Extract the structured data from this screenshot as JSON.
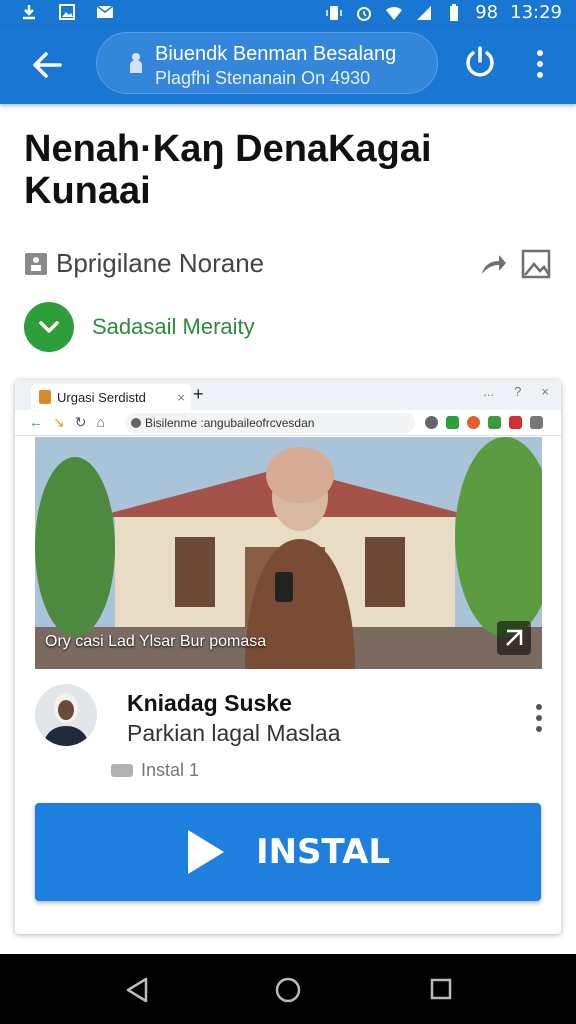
{
  "status_bar": {
    "battery": "98",
    "time": "13:29",
    "icons": [
      "download-icon",
      "gallery-icon",
      "mail-icon",
      "vibrate-icon",
      "alarm-icon",
      "wifi-icon",
      "signal-icon",
      "battery-icon"
    ]
  },
  "app_bar": {
    "url_title": "Biuendk Benman Besalang",
    "url_subtitle": "Plagfhi Stenanain On 4930",
    "icons": [
      "back-arrow-icon",
      "lock-icon",
      "power-icon",
      "more-vert-icon"
    ]
  },
  "page": {
    "title": "Nenah·Kaŋ DenaKagai Kunaai",
    "publisher": "Bprigilane Norane",
    "verified_text": "Sadasail Meraity"
  },
  "browser": {
    "tab_title": "Urgasi Serdistd",
    "new_tab": "+",
    "controls": [
      "...",
      "?",
      "×"
    ],
    "omnibox": "Bisilenme :angubaileofrcvesdan"
  },
  "video": {
    "caption": "Ory casi Lad Ylsar Bur pomasa"
  },
  "item": {
    "author_name": "Kniadag Suske",
    "author_subtitle": "Parkian lagal Maslaa",
    "install_count": "Instal 1",
    "install_label": "INSTAL"
  },
  "colors": {
    "primary": "#1976d2",
    "install_button": "#1e7fde",
    "verified_green": "#2e9e3b"
  }
}
